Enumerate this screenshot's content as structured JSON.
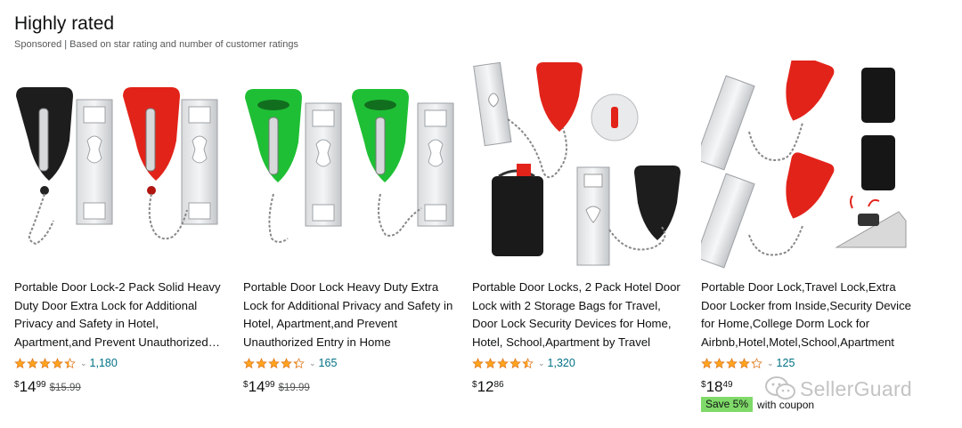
{
  "header": {
    "title": "Highly rated",
    "subtitle": "Sponsored | Based on star rating and number of customer ratings"
  },
  "products": [
    {
      "title": "Portable Door Lock-2 Pack Solid Heavy Duty Door Extra Lock for Additional Privacy and Safety in Hotel, Apartment,and Prevent Unauthorized Entry",
      "rating": 4.4,
      "rating_count": "1,180",
      "price_currency": "$",
      "price_whole": "14",
      "price_fraction": "99",
      "list_price": "$15.99"
    },
    {
      "title": "Portable Door Lock Heavy Duty Extra Lock for Additional Privacy and Safety in Hotel, Apartment,and Prevent Unauthorized Entry in Home",
      "rating": 4.3,
      "rating_count": "165",
      "price_currency": "$",
      "price_whole": "14",
      "price_fraction": "99",
      "list_price": "$19.99"
    },
    {
      "title": "Portable Door Locks, 2 Pack Hotel Door Lock with 2 Storage Bags for Travel, Door Lock Security Devices for Home, Hotel, School,Apartment by Travel",
      "rating": 4.5,
      "rating_count": "1,320",
      "price_currency": "$",
      "price_whole": "12",
      "price_fraction": "86",
      "list_price": ""
    },
    {
      "title": "Portable Door Lock,Travel Lock,Extra Door Locker from Inside,Security Device for Home,College Dorm Lock for Airbnb,Hotel,Motel,School,Apartment",
      "rating": 4.2,
      "rating_count": "125",
      "price_currency": "$",
      "price_whole": "18",
      "price_fraction": "49",
      "list_price": "",
      "coupon_badge": "Save 5%",
      "coupon_text": "with coupon"
    }
  ],
  "watermark": {
    "text": "SellerGuard"
  },
  "colors": {
    "star": "#ffa41c",
    "link": "#007185",
    "coupon": "#7fda69",
    "lock_red": "#e2231a",
    "lock_green": "#1fbf35"
  }
}
